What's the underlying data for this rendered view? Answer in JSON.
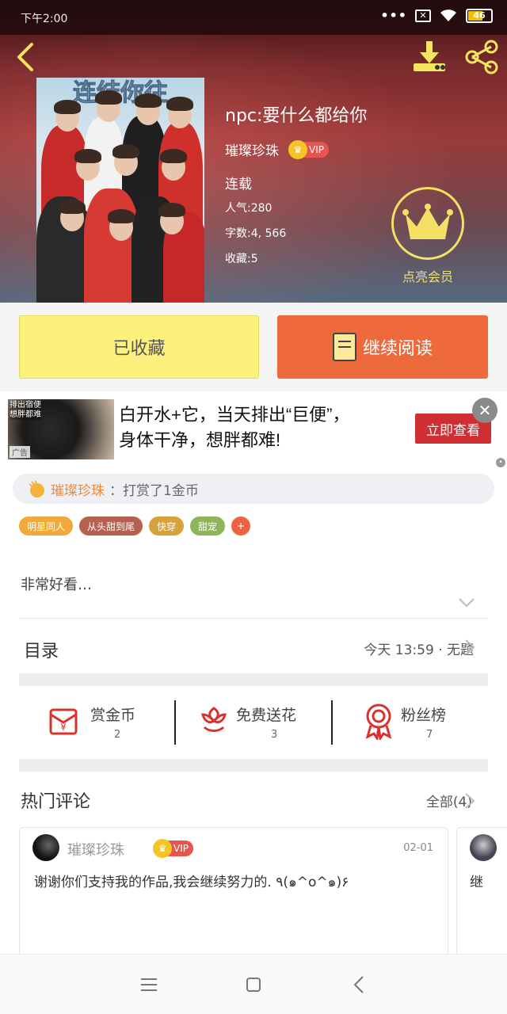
{
  "status_bar": {
    "time": "下午2:00",
    "battery": "46"
  },
  "book": {
    "cover_title": "连结你往",
    "title": "npc:要什么都给你",
    "author": "璀璨珍珠",
    "vip": "VIP",
    "status": "连载",
    "popularity": "人气:280",
    "word_count": "字数:4, 566",
    "favorites": "收藏:5"
  },
  "vip_promo": {
    "label": "点亮会员"
  },
  "actions": {
    "collected_label": "已收藏",
    "continue_label": "继续阅读"
  },
  "ad": {
    "image_text": "排出宿便\n想胖都难",
    "tag": "广告",
    "line1": "白开水+它，当天排出“巨便”，",
    "line2": "身体干净，想胖都难!",
    "cta": "立即查看"
  },
  "gift": {
    "user": "璀璨珍珠",
    "text": "：打赏了1金币"
  },
  "tags": [
    {
      "label": "明星同人",
      "color": "#f2a93b"
    },
    {
      "label": "从头甜到尾",
      "color": "#b4614f"
    },
    {
      "label": "快穿",
      "color": "#d8a23a"
    },
    {
      "label": "甜宠",
      "color": "#8fb55a"
    },
    {
      "label": "+",
      "color": "#ec6340"
    }
  ],
  "intro": "非常好看…",
  "toc": {
    "title": "目录",
    "latest": "今天 13:59 · 无题"
  },
  "stats": [
    {
      "label": "赏金币",
      "value": "2",
      "icon": "red-envelope-icon"
    },
    {
      "label": "免费送花",
      "value": "3",
      "icon": "flower-icon"
    },
    {
      "label": "粉丝榜",
      "value": "7",
      "icon": "medal-icon"
    }
  ],
  "comments": {
    "title": "热门评论",
    "all_label": "全部(4)",
    "items": [
      {
        "user": "璀璨珍珠",
        "vip": "VIP",
        "date": "02-01",
        "text": "谢谢你们支持我的作品,我会继续努力的. ٩(๑^o^๑)۶"
      },
      {
        "text": "继"
      }
    ]
  },
  "colors": {
    "accent_orange": "#ee6a3d",
    "collected_yellow": "#fcf17c",
    "vip_gold": "#f3e065"
  }
}
